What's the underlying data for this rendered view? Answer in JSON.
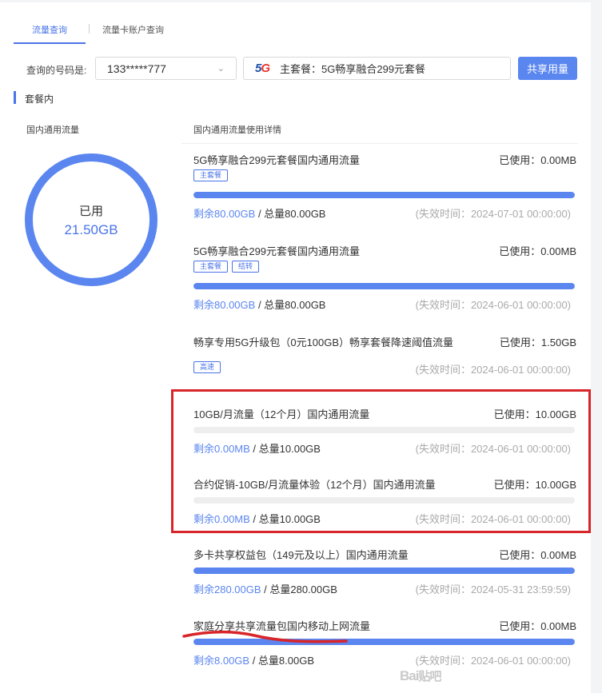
{
  "tabs": {
    "active": "流量查询",
    "other": "流量卡账户查询"
  },
  "query": {
    "label": "查询的号码是:",
    "number": "133*****777",
    "package_logo": "5G",
    "package_text": "主套餐：5G畅享融合299元套餐",
    "share_button": "共享用量"
  },
  "section_title": "套餐内",
  "columns": {
    "left": "国内通用流量",
    "right": "国内通用流量使用详情"
  },
  "ring": {
    "label": "已用",
    "value": "21.50GB"
  },
  "items": [
    {
      "title": "5G畅享融合299元套餐国内通用流量",
      "used": "已使用：0.00MB",
      "tags": [
        "主套餐"
      ],
      "remain": "剩余80.00GB",
      "total": " / 总量80.00GB",
      "expire": "(失效时间：2024-07-01 00:00:00)",
      "fill_percent": 100
    },
    {
      "title": "5G畅享融合299元套餐国内通用流量",
      "used": "已使用：0.00MB",
      "tags": [
        "主套餐",
        "结转"
      ],
      "remain": "剩余80.00GB",
      "total": " / 总量80.00GB",
      "expire": "(失效时间：2024-06-01 00:00:00)",
      "fill_percent": 100
    },
    {
      "title": "畅享专用5G升级包（0元100GB）畅享套餐降速阈值流量",
      "used": "已使用：1.50GB",
      "tags": [
        "高速"
      ],
      "expire": "(失效时间：2024-06-01 00:00:00)"
    },
    {
      "title": "10GB/月流量（12个月）国内通用流量",
      "used": "已使用：10.00GB",
      "remain": "剩余0.00MB",
      "total": " / 总量10.00GB",
      "expire": "(失效时间：2024-06-01 00:00:00)",
      "fill_percent": 0
    },
    {
      "title": "合约促销-10GB/月流量体验（12个月）国内通用流量",
      "used": "已使用：10.00GB",
      "remain": "剩余0.00MB",
      "total": " / 总量10.00GB",
      "expire": "(失效时间：2024-06-01 00:00:00)",
      "fill_percent": 0
    },
    {
      "title": "多卡共享权益包（149元及以上）国内通用流量",
      "used": "已使用：0.00MB",
      "remain": "剩余280.00GB",
      "total": " / 总量280.00GB",
      "expire": "(失效时间：2024-05-31 23:59:59)",
      "fill_percent": 100
    },
    {
      "title": "家庭分享共享流量包国内移动上网流量",
      "used": "已使用：0.00MB",
      "remain": "剩余8.00GB",
      "total": " / 总量8.00GB",
      "expire": "(失效时间：2024-06-01 00:00:00)",
      "fill_percent": 100
    }
  ],
  "watermark": {
    "latin": "Bai",
    "cn": "贴吧"
  },
  "colors": {
    "accent": "#4a74e8",
    "bar": "#5b86ef",
    "highlight": "#d8252a"
  }
}
